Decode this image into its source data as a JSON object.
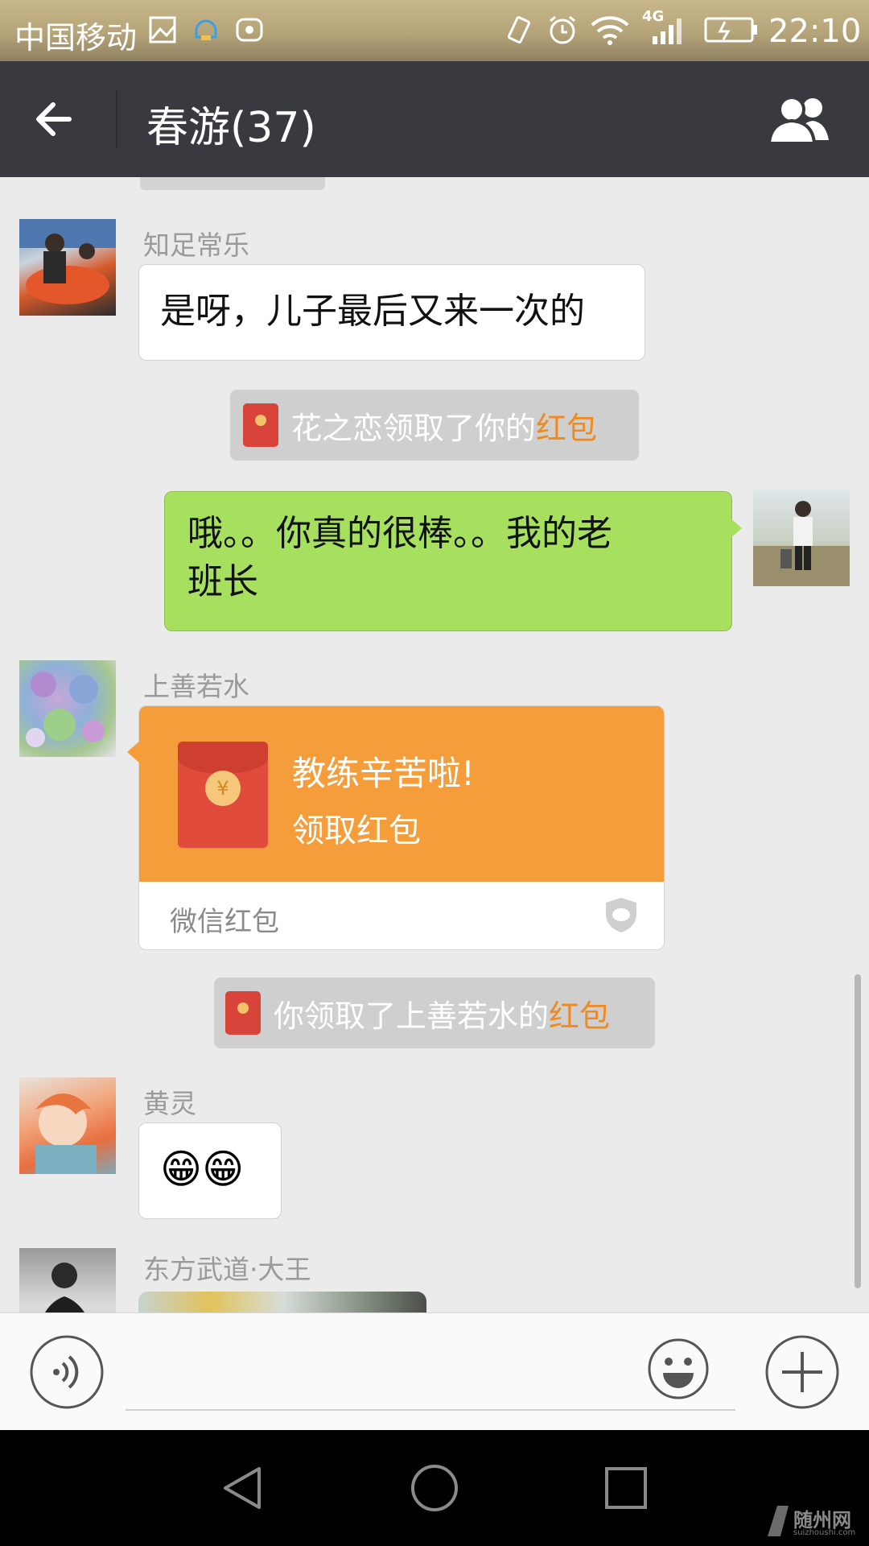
{
  "status_bar": {
    "carrier": "中国移动",
    "network": "4G",
    "time": "22:10",
    "icons": [
      "gallery-icon",
      "notification-icon",
      "huawei-icon",
      "vibrate-icon",
      "alarm-icon",
      "wifi-icon",
      "signal-icon",
      "battery-charging-icon"
    ]
  },
  "header": {
    "title": "春游(37)",
    "back_icon": "arrow-left-icon",
    "members_icon": "group-members-icon"
  },
  "messages": [
    {
      "type": "text",
      "side": "left",
      "sender": "知足常乐",
      "text": "是呀，儿子最后又来一次的"
    },
    {
      "type": "system",
      "prefix": "花之恋领取了你的",
      "highlight": "红包"
    },
    {
      "type": "text",
      "side": "right",
      "line1": "哦。。你真的很棒。。我的老",
      "line2": "班长"
    },
    {
      "type": "red_packet",
      "side": "left",
      "sender": "上善若水",
      "greeting": "教练辛苦啦!",
      "action": "领取红包",
      "footer": "微信红包"
    },
    {
      "type": "system",
      "prefix": "你领取了上善若水的",
      "highlight": "红包"
    },
    {
      "type": "emoji",
      "side": "left",
      "sender": "黄灵",
      "emoji": "😁😁"
    },
    {
      "type": "image",
      "side": "left",
      "sender": "东方武道·大王"
    }
  ],
  "input_bar": {
    "voice_icon": "voice-icon",
    "emoji_icon": "emoji-icon",
    "plus_icon": "plus-icon"
  },
  "nav_bar": {
    "back_icon": "triangle-back-icon",
    "home_icon": "circle-home-icon",
    "recents_icon": "square-recents-icon"
  },
  "watermark": {
    "name": "随州网",
    "url": "suizhoushi.com"
  },
  "colors": {
    "title_bar": "#393a3f",
    "chat_bg": "#ebebeb",
    "sent_bubble": "#a7e05f",
    "red_packet": "#f59d3b",
    "highlight": "#f08a1f"
  }
}
